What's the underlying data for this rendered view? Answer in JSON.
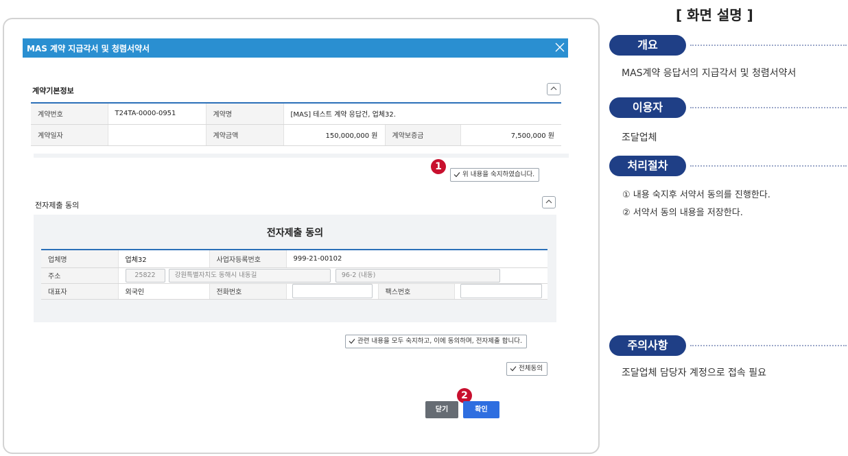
{
  "modal": {
    "title": "MAS 계약 지급각서 및 청렴서약서"
  },
  "contract_info": {
    "section_title": "계약기본정보",
    "contract_no_label": "계약번호",
    "contract_no": "T24TA-0000-0951",
    "contract_name_label": "계약명",
    "contract_name": "[MAS] 테스트 계약 응답건, 업체32.",
    "contract_date_label": "계약일자",
    "contract_date": "",
    "contract_amount_label": "계약금액",
    "contract_amount": "150,000,000  원",
    "guarantee_label": "계약보증금",
    "guarantee_amount": "7,500,000  원",
    "acknowledge_label": "위 내용을 숙지하였습니다."
  },
  "consent": {
    "section_title": "전자제출 동의",
    "box_heading": "전자제출 동의",
    "company_label": "업체명",
    "company": "업체32",
    "bizno_label": "사업자등록번호",
    "bizno": "999-21-00102",
    "address_label": "주소",
    "zipcode": "25822",
    "address1": "강원특별자치도 동해시 내동길",
    "address2": "96-2 (내동)",
    "ceo_label": "대표자",
    "ceo": "외국인",
    "phone_label": "전화번호",
    "phone": "",
    "fax_label": "팩스번호",
    "fax": "",
    "agree_label": "관련 내용을 모두 숙지하고, 이에 동의하며, 전자제출 합니다.",
    "agree_all_label": "전체동의"
  },
  "buttons": {
    "close_label": "닫기",
    "ok_label": "확인"
  },
  "badges": {
    "one": "1",
    "two": "2"
  },
  "panel": {
    "title": "[ 화면 설명 ]",
    "overview_label": "개요",
    "overview_text": "MAS계약 응답서의 지급각서 및 청렴서약서",
    "user_label": "이용자",
    "user_text": "조달업체",
    "process_label": "처리절차",
    "process_step1": "① 내용 숙지후 서약서 동의를 진행한다.",
    "process_step2": "② 서약서 동의 내용을 저장한다.",
    "caution_label": "주의사항",
    "caution_text": "조달업체 담당자 계정으로 접속 필요"
  },
  "colors": {
    "header_blue": "#2a8fd1",
    "pill_navy": "#1f3f86",
    "badge_red": "#c8102e",
    "ok_blue": "#2e6ee0"
  }
}
